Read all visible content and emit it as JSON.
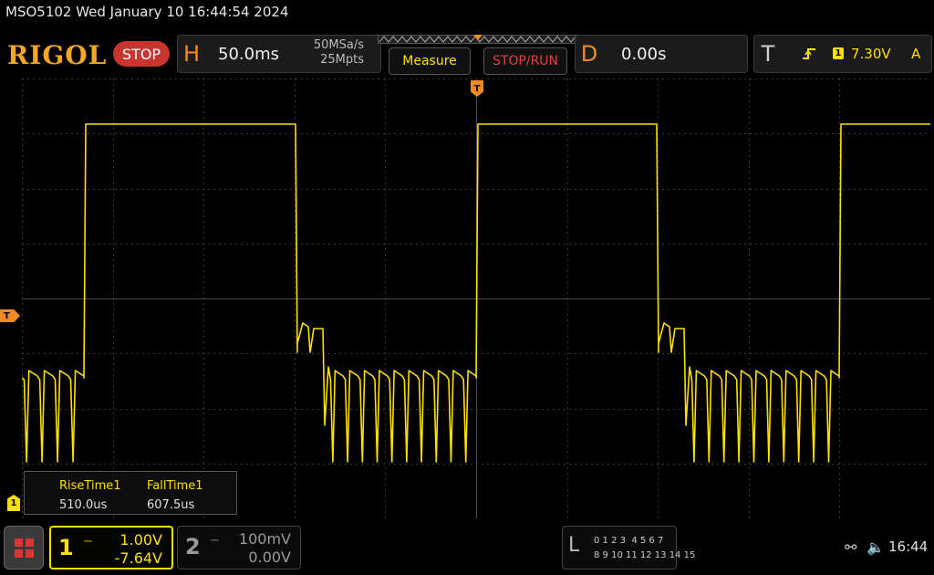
{
  "status_bar": {
    "text": "MSO5102  Wed January 10 16:44:54 2024"
  },
  "toolbar": {
    "logo": "RIGOL",
    "run_state": "STOP",
    "horizontal": {
      "letter": "H",
      "timebase": "50.0ms",
      "sample_rate": "50MSa/s",
      "memory_depth": "25Mpts"
    },
    "measure_label": "Measure",
    "stop_run_label": "STOP/RUN",
    "delay": {
      "letter": "D",
      "value": "0.00s"
    },
    "trigger": {
      "letter": "T",
      "edge_icon": "rising-edge-icon",
      "source": "1",
      "level": "7.30V",
      "mode": "A"
    }
  },
  "markers": {
    "trigger_level": "T",
    "channel1_ground": "1",
    "trigger_position": "T"
  },
  "measurements": {
    "items": [
      {
        "label": "RiseTime1",
        "value": "510.0us"
      },
      {
        "label": "FallTime1",
        "value": "607.5us"
      }
    ]
  },
  "channels": {
    "ch1": {
      "number": "1",
      "scale": "1.00V",
      "offset": "-7.64V",
      "color": "#ffe000",
      "active": true
    },
    "ch2": {
      "number": "2",
      "scale": "100mV",
      "offset": "0.00V",
      "color": "#9a9a9a",
      "active": false
    }
  },
  "logic_analyzer": {
    "letter": "L",
    "row1": "0 1 2 3  4 5 6 7",
    "row2": "8 9 10 11 12 13 14 15"
  },
  "system": {
    "usb_icon": "usb-icon",
    "speaker_icon": "speaker-muted-icon",
    "clock": "16:44"
  },
  "colors": {
    "accent": "#f08a24",
    "trace": "#ffe000",
    "stop_red": "#c8352f"
  }
}
